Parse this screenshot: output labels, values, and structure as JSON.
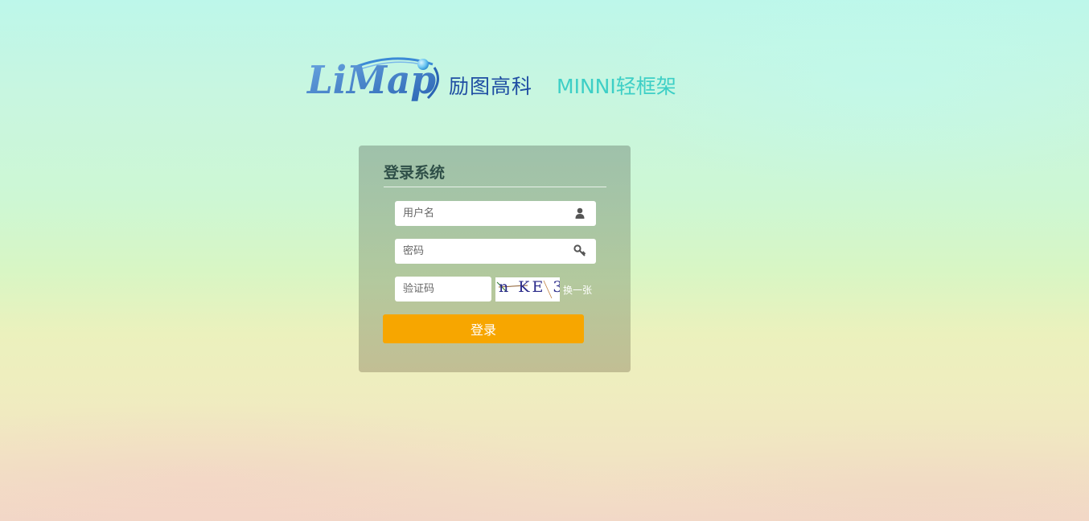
{
  "brand": {
    "logo_text": "LiMap",
    "company_name": "励图高科",
    "product_name": "MINNI轻框架",
    "colors": {
      "logo_blue": "#3b78c4",
      "company": "#1f4ea3",
      "product": "#3dcfc6"
    }
  },
  "login": {
    "title": "登录系统",
    "username": {
      "placeholder": "用户名",
      "value": "",
      "icon": "user-icon"
    },
    "password": {
      "placeholder": "密码",
      "value": "",
      "icon": "key-icon"
    },
    "captcha": {
      "placeholder": "验证码",
      "value": "",
      "image_text": "n KE 3",
      "refresh_label": "换一张"
    },
    "submit_label": "登录",
    "colors": {
      "button": "#f7a600"
    }
  }
}
